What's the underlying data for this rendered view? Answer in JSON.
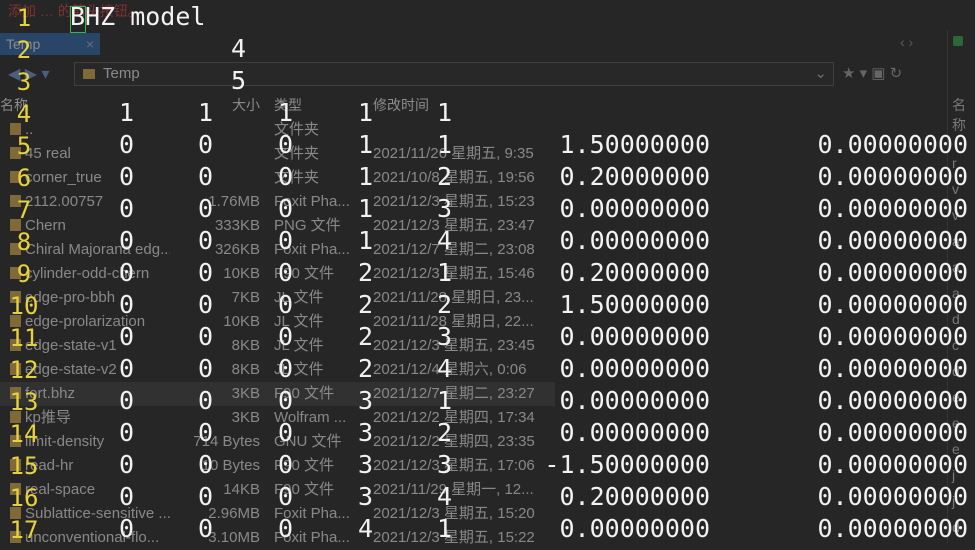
{
  "explorer": {
    "hint": "添加 … 的箭头按钮。",
    "tab": {
      "label": "Temp",
      "close": "×"
    },
    "address": "Temp",
    "columns": {
      "name": "名称",
      "size": "大小",
      "type": "类型",
      "date": "修改时间"
    },
    "right_panel": {
      "column": "名称",
      "letters": [
        "r",
        "v",
        "v",
        "a",
        "a",
        "a",
        "d",
        "c",
        "d",
        "e",
        "e",
        "e",
        "j",
        "j",
        "d"
      ]
    },
    "files": [
      {
        "name": "..",
        "size": "",
        "type": "文件夹",
        "date": ""
      },
      {
        "name": "45 real",
        "size": "",
        "type": "文件夹",
        "date": "2021/11/26 星期五, 9:35"
      },
      {
        "name": "corner_true",
        "size": "",
        "type": "文件夹",
        "date": "2021/10/8 星期五, 19:56"
      },
      {
        "name": "2112.00757",
        "size": "1.76MB",
        "type": "Foxit Pha...",
        "date": "2021/12/3 星期五, 15:23"
      },
      {
        "name": "Chern",
        "size": "333KB",
        "type": "PNG 文件",
        "date": "2021/12/3 星期五, 23:47"
      },
      {
        "name": "Chiral Majorana edg...",
        "size": "326KB",
        "type": "Foxit Pha...",
        "date": "2021/12/7 星期二, 23:08"
      },
      {
        "name": "cylinder-odd-chern",
        "size": "10KB",
        "type": "F90 文件",
        "date": "2021/12/3 星期五, 15:46"
      },
      {
        "name": "edge-pro-bbh",
        "size": "7KB",
        "type": "JL 文件",
        "date": "2021/11/28 星期日, 23..."
      },
      {
        "name": "edge-prolarization",
        "size": "10KB",
        "type": "JL 文件",
        "date": "2021/11/28 星期日, 22..."
      },
      {
        "name": "edge-state-v1",
        "size": "8KB",
        "type": "JL 文件",
        "date": "2021/12/3 星期五, 23:45"
      },
      {
        "name": "edge-state-v2",
        "size": "8KB",
        "type": "JL 文件",
        "date": "2021/12/4 星期六, 0:06"
      },
      {
        "name": "fort.bhz",
        "size": "3KB",
        "type": "F90 文件",
        "date": "2021/12/7 星期二, 23:27"
      },
      {
        "name": "kp推导",
        "size": "3KB",
        "type": "Wolfram ...",
        "date": "2021/12/2 星期四, 17:34"
      },
      {
        "name": "limit-density",
        "size": "714 Bytes",
        "type": "GNU 文件",
        "date": "2021/12/2 星期四, 23:35"
      },
      {
        "name": "read-hr",
        "size": "10 Bytes",
        "type": "F90 文件",
        "date": "2021/12/3 星期五, 17:06"
      },
      {
        "name": "real-space",
        "size": "14KB",
        "type": "F90 文件",
        "date": "2021/11/29 星期一, 12..."
      },
      {
        "name": "Sublattice-sensitive ...",
        "size": "2.96MB",
        "type": "Foxit Pha...",
        "date": "2021/12/3 星期五, 15:20"
      },
      {
        "name": "unconventional-flo...",
        "size": "3.10MB",
        "type": "Foxit Pha...",
        "date": "2021/12/3 星期五, 15:22"
      }
    ]
  },
  "editor": {
    "line_numbers": [
      "1",
      "2",
      "3",
      "4",
      "5",
      "6",
      "7",
      "8",
      "9",
      "10",
      "11",
      "12",
      "13",
      "14",
      "15",
      "16",
      "17"
    ],
    "title_line": "BHZ model",
    "line2": "4",
    "line3": "5",
    "rows": [
      [
        "1",
        "1",
        "1",
        "1",
        "1",
        "",
        ""
      ],
      [
        "0",
        "0",
        "0",
        "1",
        "1",
        "1.50000000",
        "0.00000000"
      ],
      [
        "0",
        "0",
        "0",
        "1",
        "2",
        "0.20000000",
        "0.00000000"
      ],
      [
        "0",
        "0",
        "0",
        "1",
        "3",
        "0.00000000",
        "0.00000000"
      ],
      [
        "0",
        "0",
        "0",
        "1",
        "4",
        "0.00000000",
        "0.00000000"
      ],
      [
        "0",
        "0",
        "0",
        "2",
        "1",
        "0.20000000",
        "0.00000000"
      ],
      [
        "0",
        "0",
        "0",
        "2",
        "2",
        "1.50000000",
        "0.00000000"
      ],
      [
        "0",
        "0",
        "0",
        "2",
        "3",
        "0.00000000",
        "0.00000000"
      ],
      [
        "0",
        "0",
        "0",
        "2",
        "4",
        "0.00000000",
        "0.00000000"
      ],
      [
        "0",
        "0",
        "0",
        "3",
        "1",
        "0.00000000",
        "0.00000000"
      ],
      [
        "0",
        "0",
        "0",
        "3",
        "2",
        "0.00000000",
        "0.00000000"
      ],
      [
        "0",
        "0",
        "0",
        "3",
        "3",
        "-1.50000000",
        "0.00000000"
      ],
      [
        "0",
        "0",
        "0",
        "3",
        "4",
        "0.20000000",
        "0.00000000"
      ],
      [
        "0",
        "0",
        "0",
        "4",
        "1",
        "0.00000000",
        "0.00000000"
      ]
    ]
  }
}
